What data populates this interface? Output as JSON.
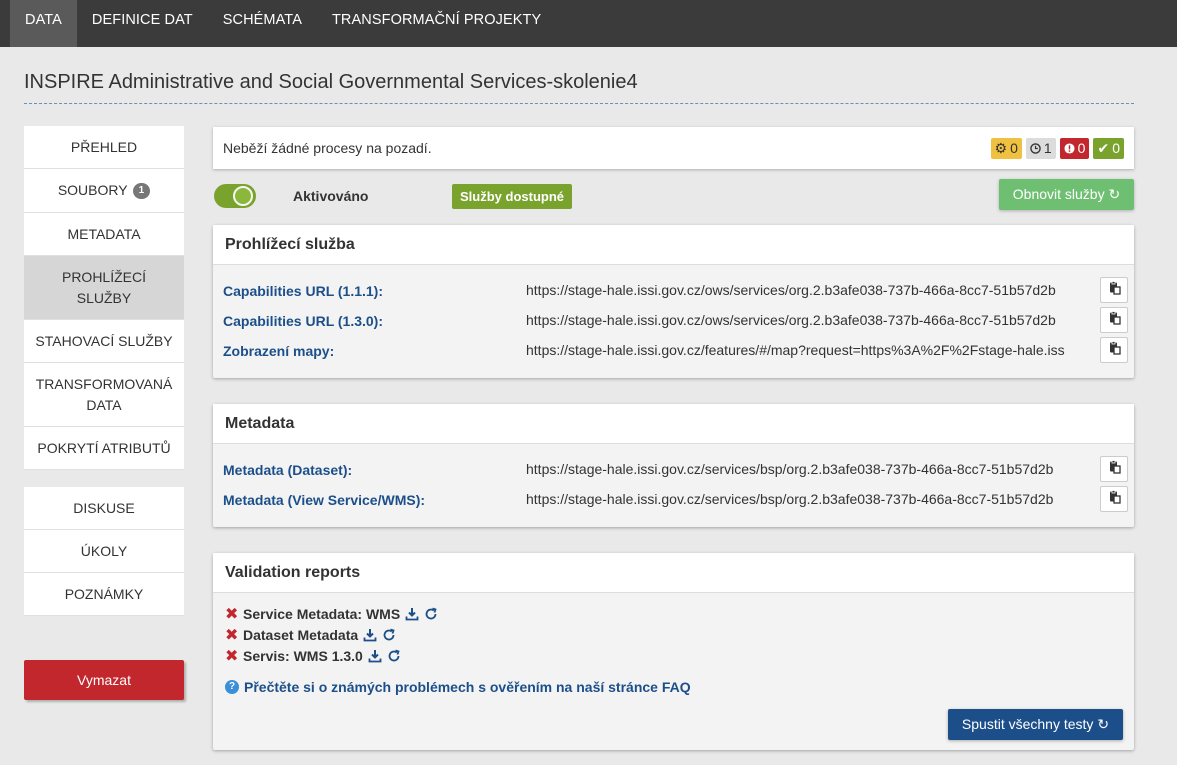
{
  "topnav": {
    "items": [
      {
        "label": "DATA",
        "active": true
      },
      {
        "label": "DEFINICE DAT",
        "active": false
      },
      {
        "label": "SCHÉMATA",
        "active": false
      },
      {
        "label": "TRANSFORMAČNÍ PROJEKTY",
        "active": false
      }
    ]
  },
  "page": {
    "title": "INSPIRE Administrative and Social Governmental Services-skolenie4"
  },
  "sidebar": {
    "items": [
      {
        "label": "PŘEHLED"
      },
      {
        "label": "SOUBORY",
        "badge": "1"
      },
      {
        "label": "METADATA"
      },
      {
        "label": "PROHLÍŽECÍ SLUŽBY",
        "active": true
      },
      {
        "label": "STAHOVACÍ SLUŽBY"
      },
      {
        "label": "TRANSFORMOVANÁ DATA"
      },
      {
        "label": "POKRYTÍ ATRIBUTŮ"
      }
    ],
    "items2": [
      {
        "label": "DISKUSE"
      },
      {
        "label": "ÚKOLY"
      },
      {
        "label": "POZNÁMKY"
      }
    ],
    "delete_label": "Vymazat"
  },
  "status": {
    "message": "Neběží žádné procesy na pozadí.",
    "counts": {
      "processing": "0",
      "waiting": "1",
      "errors": "0",
      "done": "0"
    }
  },
  "service": {
    "toggle_label": "Aktivováno",
    "badge": "Služby dostupné",
    "refresh_label": "Obnovit služby"
  },
  "view_service": {
    "title": "Prohlížecí služba",
    "rows": [
      {
        "label": "Capabilities URL (1.1.1):",
        "value": "https://stage-hale.issi.gov.cz/ows/services/org.2.b3afe038-737b-466a-8cc7-51b57d2b"
      },
      {
        "label": "Capabilities URL (1.3.0):",
        "value": "https://stage-hale.issi.gov.cz/ows/services/org.2.b3afe038-737b-466a-8cc7-51b57d2b"
      },
      {
        "label": "Zobrazení mapy:",
        "value": "https://stage-hale.issi.gov.cz/features/#/map?request=https%3A%2F%2Fstage-hale.iss"
      }
    ]
  },
  "metadata": {
    "title": "Metadata",
    "rows": [
      {
        "label": "Metadata (Dataset):",
        "value": "https://stage-hale.issi.gov.cz/services/bsp/org.2.b3afe038-737b-466a-8cc7-51b57d2b"
      },
      {
        "label": "Metadata (View Service/WMS):",
        "value": "https://stage-hale.issi.gov.cz/services/bsp/org.2.b3afe038-737b-466a-8cc7-51b57d2b"
      }
    ]
  },
  "validation": {
    "title": "Validation reports",
    "reports": [
      {
        "label": "Service Metadata: WMS"
      },
      {
        "label": "Dataset Metadata"
      },
      {
        "label": "Servis: WMS 1.3.0"
      }
    ],
    "faq_label": "Přečtěte si o známých problémech s ověřením na naší stránce FAQ",
    "run_all_label": "Spustit všechny testy"
  },
  "colors": {
    "accent_blue": "#1c4f8a",
    "success_green": "#7aa32e",
    "danger_red": "#c1272d",
    "warning_yellow": "#f0c040"
  }
}
